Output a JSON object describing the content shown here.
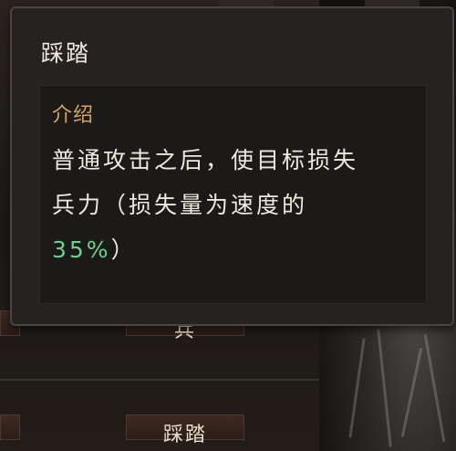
{
  "background": {
    "tab_bottom_label": "踩踏",
    "tab_mid_label": "兵"
  },
  "tooltip": {
    "title": "踩踏",
    "section_label": "介绍",
    "description_before": "普通攻击之后，使目标损失兵力（损失量为速度的",
    "description_value": "35%",
    "description_after": "）"
  },
  "colors": {
    "title": "#efe8de",
    "section_label": "#d3a459",
    "highlight": "#6fcf90",
    "panel": "#252220"
  }
}
